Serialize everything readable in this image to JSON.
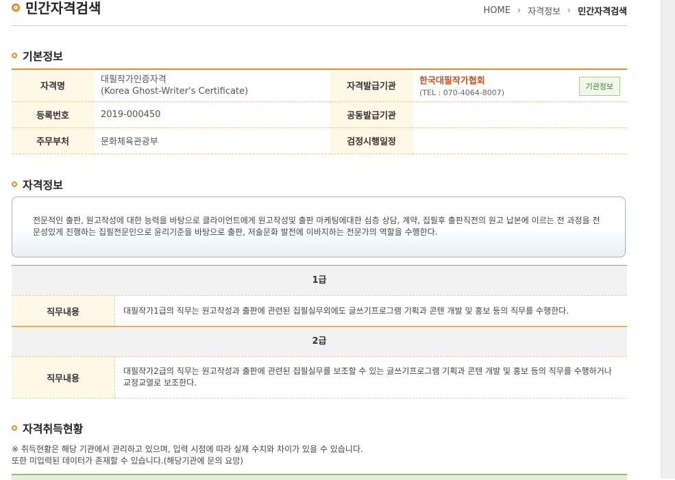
{
  "page": {
    "title": "민간자격검색",
    "breadcrumb": [
      "HOME",
      "자격정보",
      "민간자격검색"
    ]
  },
  "sections": {
    "basic": "기본정보",
    "qualification": "자격정보",
    "acquisition": "자격취득현황"
  },
  "basic_info": {
    "name_label": "자격명",
    "name_value_1": "대필작가인증자격",
    "name_value_2": "(Korea Ghost-Writer's Certificate)",
    "issuer_label": "자격발급기관",
    "issuer_name": "한국대필작가협회",
    "issuer_tel": "(TEL : 070-4064-8007)",
    "issuer_button": "기관정보",
    "reg_label": "등록번호",
    "reg_value": "2019-000450",
    "co_issuer_label": "공동발급기관",
    "co_issuer_value": "",
    "ministry_label": "주무부처",
    "ministry_value": "문화체육관광부",
    "exam_label": "검정시행일정",
    "exam_value": ""
  },
  "description": "전문적인 출판, 원고작성에 대한 능력을 바탕으로 클라이언트에게 원고작성및 출판 마케팅에대한 심층 상담, 계약, 집필후 출판직전의 원고 납본에 이르는 전 과정을 전문성있게 진행하는 집필전문인으로 윤리기준을 바탕으로 출판, 저술문화 발전에 이바지하는 전문가의 역할을 수행한다.",
  "grades": [
    {
      "grade": "1급",
      "label": "직무내용",
      "content": "대필작가1급의 직무는 원고작성과 출판에 관련된 집필실무외에도 글쓰기프로그램 기획과 콘텐 개발 및 홍보 등의 직무를 수행한다."
    },
    {
      "grade": "2급",
      "label": "직무내용",
      "content": "대필작가2급의 직무는 원고작성과 출판에 관련된 집필실무를 보조할 수 있는 글쓰기프로그램 기획과 콘텐 개발 및 홍보 등의 직무를 수행하거나 교정교열로 보조한다."
    }
  ],
  "notes": {
    "line1": "※ 취득현황은 해당 기관에서 관리하고 있으며, 입력 시점에 따라 실제 수치와 차이가 있을 수 있습니다.",
    "line2": "또한 미입력된 데이터가 존재할 수 있습니다.(해당기관에 문의 요망)"
  },
  "colors": {
    "accent": "#f08a24",
    "issuer": "#c0541f",
    "header_bg": "#fff8e6"
  }
}
